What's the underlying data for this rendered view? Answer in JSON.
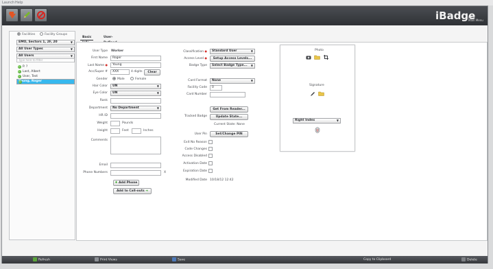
{
  "menubar": {
    "file": "Launch",
    "help": "Help"
  },
  "app": {
    "brand": "iBadge",
    "brand_sub_1": "Help",
    "brand_sub_2": "Main Menu"
  },
  "toolbar": {
    "btn1_icon": "app-home-icon",
    "btn2_icon": "edit-pencil-icon",
    "btn3_icon": "cancel-icon"
  },
  "left": {
    "radio_facilities": "Facilities",
    "radio_facility_groups": "Facility Groups",
    "facility_select": "EMO, Sectors 1, 2F, 20",
    "user_types_select": "All User Types",
    "users_select": "All Users",
    "filter_placeholder": "Type here to filter",
    "users": [
      {
        "name": "P. ?",
        "selected": false
      },
      {
        "name": "Last, Albert",
        "selected": false
      },
      {
        "name": "User, Test",
        "selected": false
      },
      {
        "name": "Young, Roger",
        "selected": true
      }
    ]
  },
  "tabs": {
    "basic": "Basic Info",
    "user_defined": "User-Defined Fields"
  },
  "form": {
    "user_type_label": "User Type",
    "user_type_value": "Worker",
    "first_name_label": "First Name",
    "first_name_value": "Roger",
    "last_name_label": "Last Name",
    "last_name_value": "Young",
    "ssn_label": "Acc/Super #",
    "ssn_value": "XXX",
    "digits_label": "4 digits",
    "clear_btn": "Clear",
    "gender_label": "Gender",
    "male": "Male",
    "female": "Female",
    "hair_color_label": "Hair Color",
    "hair_color_value": "UN",
    "eye_color_label": "Eye Color",
    "eye_color_value": "UN",
    "rank_label": "Rank",
    "department_label": "Department",
    "department_value": "No Department",
    "hr_id_label": "HR ID",
    "weight_label": "Weight",
    "pounds": "Pounds",
    "height_label": "Height",
    "feet": "Feet",
    "inches": "Inches",
    "comments_label": "Comments",
    "email_label": "Email",
    "phone_label": "Phone Numbers",
    "phone_x": "X",
    "add_phone_btn": "Add Phone",
    "add_callouts_btn": "Add to Call-outs"
  },
  "form_right": {
    "classification_label": "Classification",
    "classification_value": "Standard User",
    "access_level_label": "Access Level",
    "access_level_btn": "Setup Access Levels...",
    "badge_type_label": "Badge Type",
    "badge_type_value": "Select Badge Type...",
    "card_format_label": "Card Format",
    "card_format_value": "None",
    "facility_code_label": "Facility Code",
    "facility_code_value": "0",
    "card_number_label": "Card Number",
    "get_from_reader_btn": "Get From Reader...",
    "tracked_badge_label": "Tracked Badge",
    "update_state_btn": "Update State...",
    "current_state": "Current State: None",
    "user_pin_label": "User Pin",
    "set_pin_btn": "Set/Change PIN",
    "exit_no_reason_label": "Exit No Reason",
    "code_changes_label": "Code Changes",
    "access_disabled_label": "Access Disabled",
    "activation_date_label": "Activation Date",
    "expiration date_label": "Expiration Date",
    "modified_date_label": "Modified Date",
    "modified_date_value": "10/18/12 12:42"
  },
  "card_panel": {
    "photo_label": "Photo",
    "signature_label": "Signature",
    "finger_select": "Right Index",
    "camera_icon": "camera-icon",
    "folder_icon": "folder-icon",
    "crop_icon": "crop-icon",
    "pen_icon": "pen-icon",
    "fingerprint_icon": "fingerprint-icon"
  },
  "bottombar": {
    "refresh": "Refresh",
    "print_views": "Print Views",
    "save": "Save",
    "copy_clipboard": "Copy to Clipboard",
    "delete": "Delete"
  },
  "colors": {
    "selection": "#37b8ee",
    "titlebar": "#3a3c40",
    "required": "#d4322e"
  }
}
